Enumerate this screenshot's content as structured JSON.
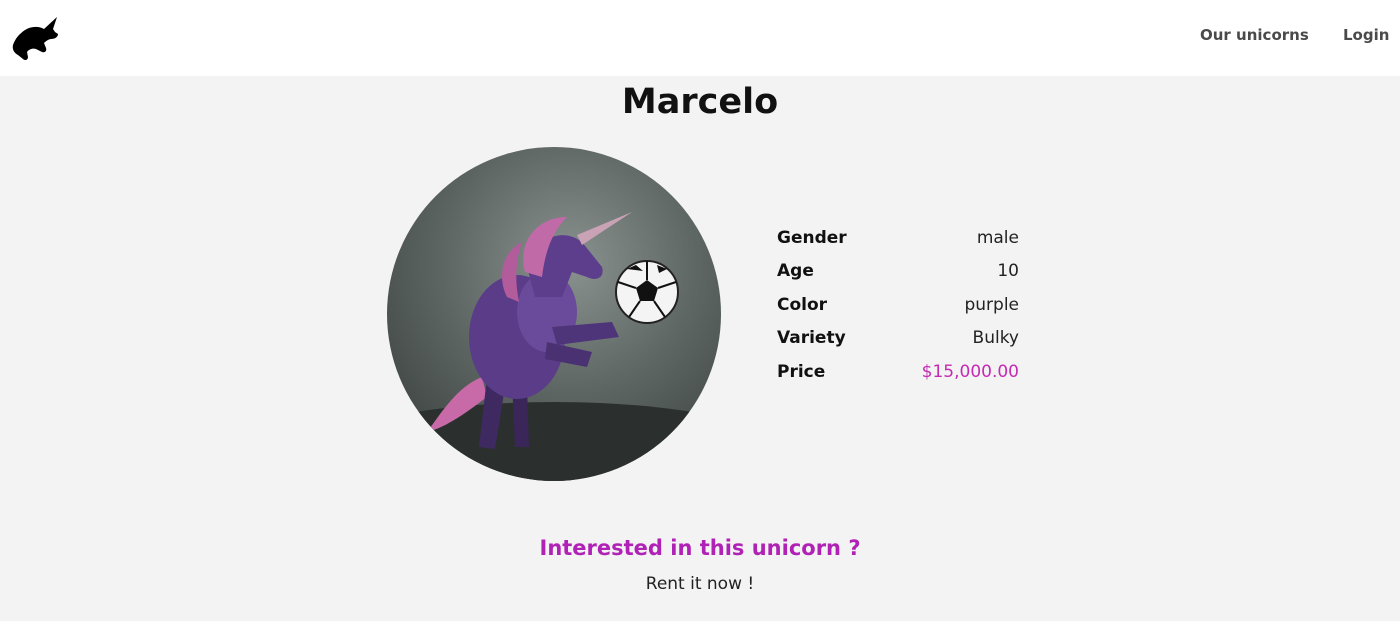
{
  "nav": {
    "links": [
      {
        "label": "Our unicorns"
      },
      {
        "label": "Login"
      }
    ]
  },
  "unicorn": {
    "name": "Marcelo",
    "details": [
      {
        "label": "Gender",
        "value": "male"
      },
      {
        "label": "Age",
        "value": "10"
      },
      {
        "label": "Color",
        "value": "purple"
      },
      {
        "label": "Variety",
        "value": "Bulky"
      },
      {
        "label": "Price",
        "value": "$15,000.00"
      }
    ]
  },
  "cta": {
    "title": "Interested in this unicorn ?",
    "subtitle": "Rent it now !"
  },
  "colors": {
    "accent": "#b022b5",
    "price": "#c42bb3",
    "background": "#f3f3f3"
  },
  "icons": [
    "unicorn-logo-icon"
  ]
}
